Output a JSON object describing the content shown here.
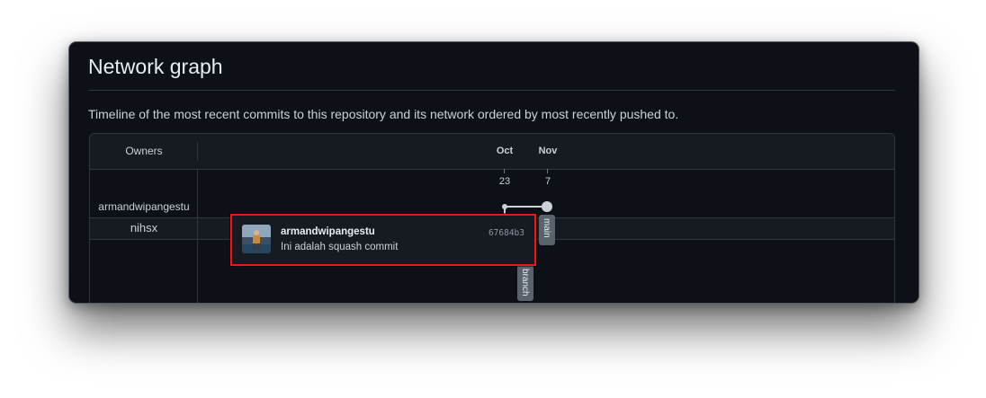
{
  "page": {
    "title": "Network graph",
    "description": "Timeline of the most recent commits to this repository and its network ordered by most recently pushed to."
  },
  "graph": {
    "owners_header": "Owners",
    "months": [
      "Oct",
      "Nov"
    ],
    "days": [
      "23",
      "7"
    ],
    "owners": [
      "armandwipangestu",
      "nihsx"
    ],
    "branches": [
      "main",
      "branch"
    ]
  },
  "tooltip": {
    "author": "armandwipangestu",
    "message": "Ini adalah squash commit",
    "sha": "67684b3"
  },
  "icons": {
    "avatar": "user-avatar-photo"
  },
  "colors": {
    "background": "#0d1117",
    "header_bg": "#161b22",
    "border": "#30363d",
    "text": "#c9d1d9",
    "highlight": "#ff1010",
    "branch_label_bg": "#5a626b"
  }
}
